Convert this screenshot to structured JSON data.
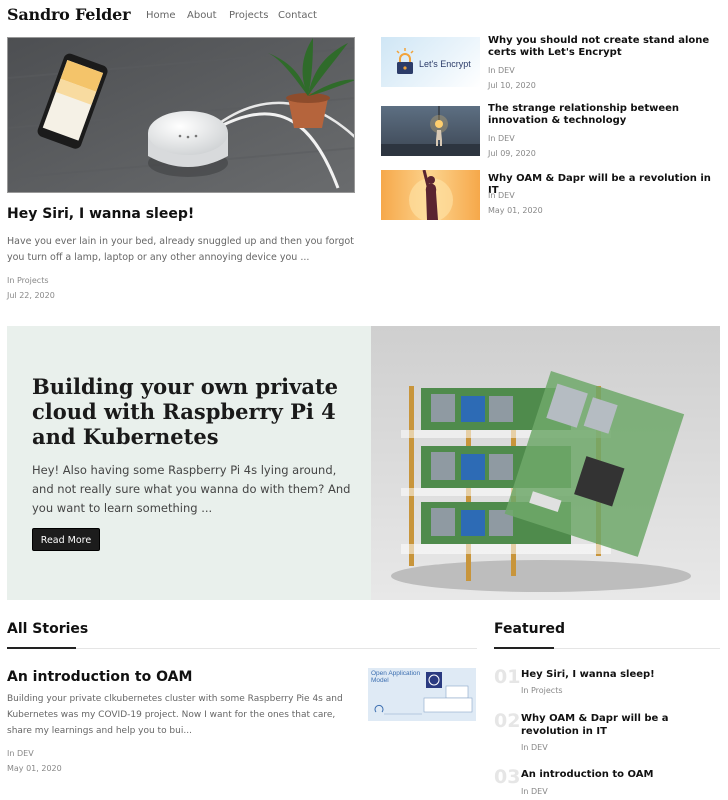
{
  "nav": {
    "brand": "Sandro Felder",
    "links": [
      "Home",
      "About",
      "Projects",
      "Contact"
    ]
  },
  "hero": {
    "title": "Hey Siri, I wanna sleep!",
    "excerpt": "Have you ever lain in your bed, already snuggled up and then you forgot you turn off a lamp, laptop or any other annoying device you ...",
    "category": "In Projects",
    "date": "Jul 22, 2020"
  },
  "side_posts": [
    {
      "title": "Why you should not create stand alone certs with Let's Encrypt",
      "category": "In DEV",
      "date": "Jul 10, 2020",
      "thumb_text": "Let's Encrypt"
    },
    {
      "title": "The strange relationship between innovation & technology",
      "category": "In DEV",
      "date": "Jul 09, 2020"
    },
    {
      "title": "Why OAM & Dapr will be a revolution in IT",
      "category": "In DEV",
      "date": "May 01, 2020"
    }
  ],
  "banner": {
    "title": "Building your own private cloud with Raspberry Pi 4 and Kubernetes",
    "excerpt": "Hey! Also having some Raspberry Pi 4s lying around, and not really sure what you wanna do with them? And you want to learn something ...",
    "button": "Read More"
  },
  "all_stories": {
    "heading": "All Stories",
    "items": [
      {
        "title": "An introduction to OAM",
        "excerpt": "Building your private clkubernetes cluster with some Raspberry Pie 4s and Kubernetes was my COVID-19 project. Now I want for the ones that care, share my learnings and help you to bui...",
        "category": "In DEV",
        "date": "May 01, 2020",
        "thumb_text": "Open Application Model"
      }
    ]
  },
  "featured": {
    "heading": "Featured",
    "items": [
      {
        "num": "01",
        "title": "Hey Siri, I wanna sleep!",
        "category": "In Projects"
      },
      {
        "num": "02",
        "title": "Why OAM & Dapr will be a revolution in IT",
        "category": "In DEV"
      },
      {
        "num": "03",
        "title": "An introduction to OAM",
        "category": "In DEV"
      }
    ]
  },
  "colors": {
    "banner_bg": "#e9f0ec",
    "button_bg": "#1c1c1c",
    "accent_text": "#111111"
  }
}
